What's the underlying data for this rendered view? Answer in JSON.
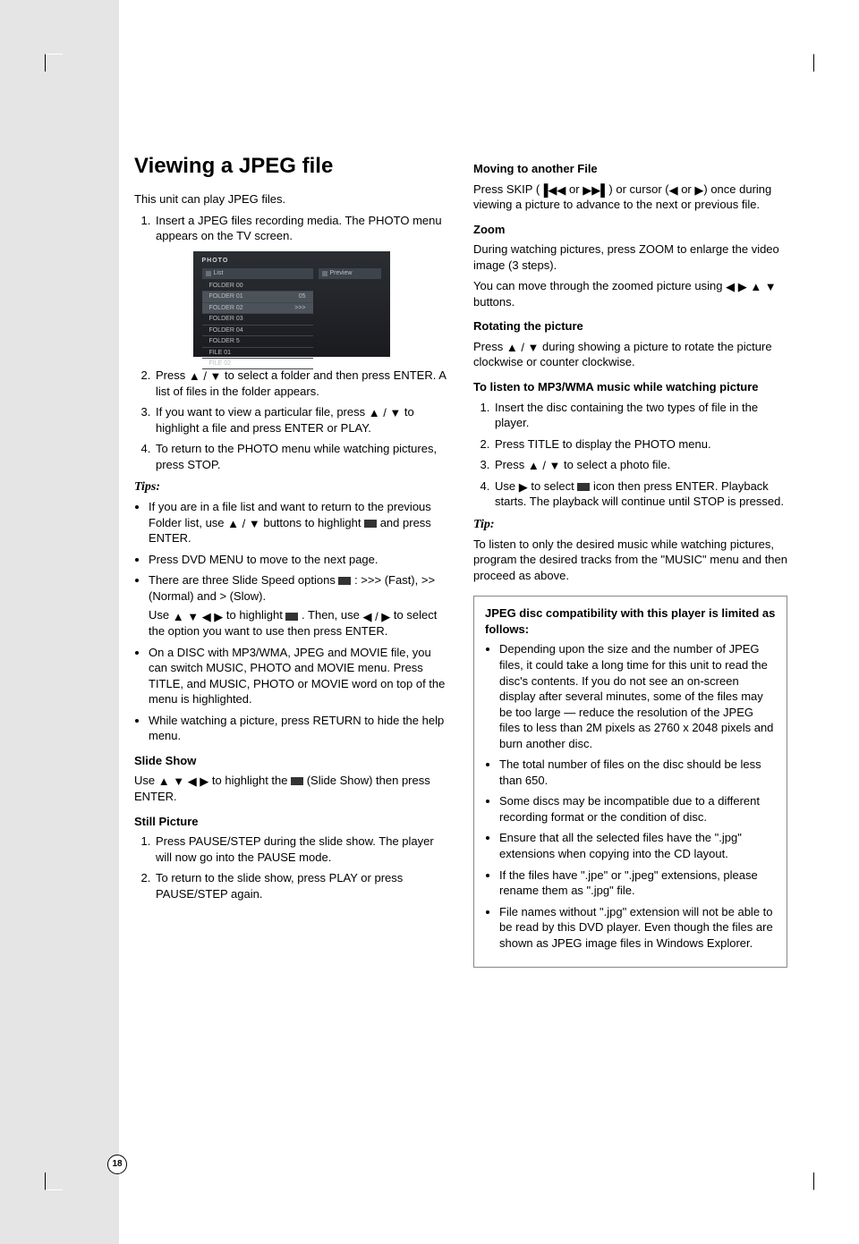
{
  "page_number": "18",
  "left": {
    "title": "Viewing a JPEG file",
    "intro": "This unit can play JPEG files.",
    "step1": "Insert a JPEG files recording media. The PHOTO menu appears on the TV screen.",
    "step2a": "Press ",
    "step2b": " to select a folder and then press ENTER. A list of files in the folder appears.",
    "step3a": "If you want to view a particular file, press ",
    "step3b": " to highlight a file and press ENTER or PLAY.",
    "step4": "To return to the PHOTO menu while watching pictures, press STOP.",
    "tips_label": "Tips:",
    "tip1a": "If you are in a file list and want to return to the previous Folder list, use ",
    "tip1b": " buttons to highlight ",
    "tip1c": " and press ENTER.",
    "tip2": "Press DVD MENU to move to the next page.",
    "tip3a": "There are three Slide Speed options ",
    "tip3b": " : >>> (Fast), >> (Normal) and > (Slow).",
    "tip3c": "Use ",
    "tip3d": " to highlight ",
    "tip3e": " . Then, use ",
    "tip3f": " to select the option you want to use then press ENTER.",
    "tip4": "On a DISC with MP3/WMA, JPEG and MOVIE file, you can switch MUSIC, PHOTO and MOVIE menu. Press TITLE, and MUSIC, PHOTO or MOVIE word on top of the menu is highlighted.",
    "tip5": "While watching a picture, press RETURN to hide the help menu.",
    "slide_show_h": "Slide Show",
    "slide_show_a": "Use ",
    "slide_show_b": " to highlight the ",
    "slide_show_c": " (Slide Show) then press ENTER.",
    "still_h": "Still Picture",
    "still1": "Press PAUSE/STEP during the slide show. The player will now go into the PAUSE mode.",
    "still2": "To return to the slide show, press PLAY or press PAUSE/STEP again.",
    "ss": {
      "title": "PHOTO",
      "list": "List",
      "preview": "Preview",
      "rows": [
        "FOLDER 00",
        "FOLDER 01",
        "FOLDER 02",
        "FOLDER 03",
        "FOLDER 04",
        "FOLDER 5",
        "FILE 01",
        "FILE 02"
      ],
      "sel": "05",
      "speed": ">>>"
    }
  },
  "right": {
    "move_h": "Moving to another File",
    "move_a": "Press SKIP (",
    "move_b": " or ",
    "move_c": ") or cursor (",
    "move_d": " or ",
    "move_e": ") once during viewing a picture to advance to the next or previous file.",
    "zoom_h": "Zoom",
    "zoom_p1": "During watching pictures, press ZOOM to enlarge the video image (3 steps).",
    "zoom_p2a": "You can move through the zoomed picture using ",
    "zoom_p2b": " buttons.",
    "rot_h": "Rotating the picture",
    "rot_a": "Press ",
    "rot_b": " during showing a picture to rotate the picture clockwise or counter clockwise.",
    "mp3_h": "To listen to MP3/WMA music while watching picture",
    "mp3_1": "Insert the disc containing the two types of file in the player.",
    "mp3_2": "Press TITLE to display the PHOTO menu.",
    "mp3_3a": "Press ",
    "mp3_3b": " to select a photo file.",
    "mp3_4a": "Use ",
    "mp3_4b": " to select ",
    "mp3_4c": " icon then press ENTER. Playback starts. The playback will continue until STOP is pressed.",
    "tip_label": "Tip:",
    "tip_body": "To listen to only the desired music while watching pictures, program the desired tracks from the \"MUSIC\" menu and then proceed as above.",
    "box_h": "JPEG disc compatibility with this player is limited as follows:",
    "box1": "Depending upon the size and the number of JPEG files, it could take a long time for this unit to read the disc's contents. If you do not see an on-screen display after several minutes, some of the files may be too large — reduce the resolution of the JPEG files to less than 2M pixels as 2760 x 2048 pixels and burn another disc.",
    "box2": "The total number of files on the disc should be less than 650.",
    "box3": "Some discs may be incompatible due to a different recording format or the condition of disc.",
    "box4": "Ensure that all the selected files have the \".jpg\" extensions when copying into the CD layout.",
    "box5": "If the files have \".jpe\" or \".jpeg\" extensions, please rename them as \".jpg\" file.",
    "box6": "File names without \".jpg\" extension will not be able to be read by this DVD player. Even though the files are shown as JPEG image files in Windows Explorer."
  },
  "sym": {
    "up": "▲",
    "down": "▼",
    "left": "◀",
    "right": "▶",
    "updown": "▲ / ▼",
    "leftright": "◀ / ▶",
    "all4": "▲ ▼ ◀ ▶",
    "lrud": "◀ ▶ ▲ ▼",
    "prev": "▐◀◀",
    "next": "▶▶▌",
    "folder_up": "📁..",
    "speed_icon": "⧉:",
    "slideshow_icon": "▦",
    "music_icon": "⧉♪"
  }
}
